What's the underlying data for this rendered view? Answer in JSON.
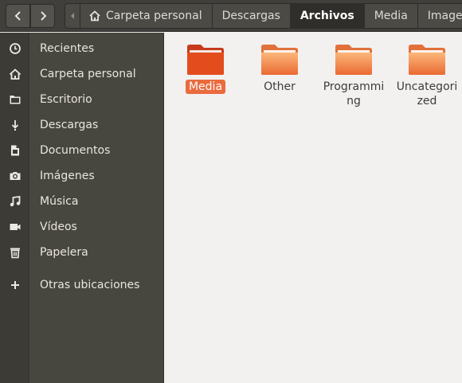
{
  "header": {
    "back_icon": "chevron-left-icon",
    "forward_icon": "chevron-right-icon",
    "scroll_icon": "triangle-left-icon",
    "breadcrumbs": [
      {
        "label": "Carpeta personal",
        "icon": "home-icon"
      },
      {
        "label": "Descargas"
      },
      {
        "label": "Archivos",
        "active": true
      },
      {
        "label": "Media"
      },
      {
        "label": "Images"
      }
    ]
  },
  "sidebar": {
    "items": [
      {
        "label": "Recientes",
        "icon": "clock-icon"
      },
      {
        "label": "Carpeta personal",
        "icon": "home-icon"
      },
      {
        "label": "Escritorio",
        "icon": "folder-icon"
      },
      {
        "label": "Descargas",
        "icon": "download-icon"
      },
      {
        "label": "Documentos",
        "icon": "document-icon"
      },
      {
        "label": "Imágenes",
        "icon": "camera-icon"
      },
      {
        "label": "Música",
        "icon": "music-icon"
      },
      {
        "label": "Vídeos",
        "icon": "video-icon"
      },
      {
        "label": "Papelera",
        "icon": "trash-icon"
      },
      {
        "label": "Otras ubicaciones",
        "icon": "plus-icon"
      }
    ]
  },
  "files": [
    {
      "name": "Media",
      "selected": true
    },
    {
      "name": "Other"
    },
    {
      "name": "Programming"
    },
    {
      "name": "Uncategorized"
    }
  ],
  "colors": {
    "accent": "#e95420",
    "header_bg": "#403f3b",
    "sidebar_bg": "#47463f",
    "content_bg": "#f2f1f0"
  }
}
